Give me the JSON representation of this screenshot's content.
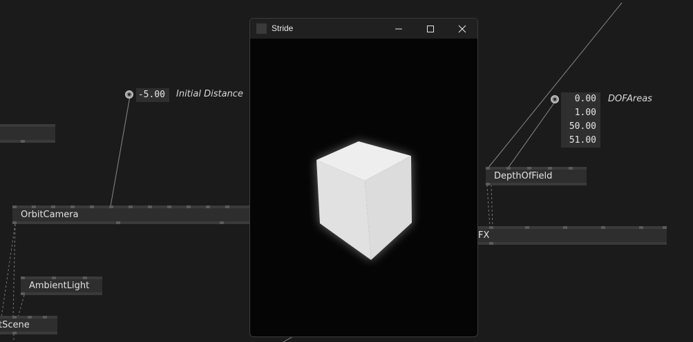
{
  "window": {
    "title": "Stride",
    "controls": [
      "minimize-icon",
      "maximize-icon",
      "close-icon"
    ]
  },
  "iobox_initial_distance": {
    "value": "-5.00",
    "label": "Initial Distance"
  },
  "iobox_dof_areas": {
    "values": [
      "0.00",
      "1.00",
      "50.00",
      "51.00"
    ],
    "label": "DOFAreas"
  },
  "nodes": {
    "orbit_camera": "OrbitCamera",
    "ambient_light": "AmbientLight",
    "scene": "tScene",
    "depth_of_field": "DepthOfField",
    "fx": "FX"
  },
  "colors": {
    "background": "#1b1b1b",
    "node": "#2e2e2e",
    "titlebar": "#202020",
    "viewport": "#050505",
    "cube": "#e4e4e4"
  }
}
